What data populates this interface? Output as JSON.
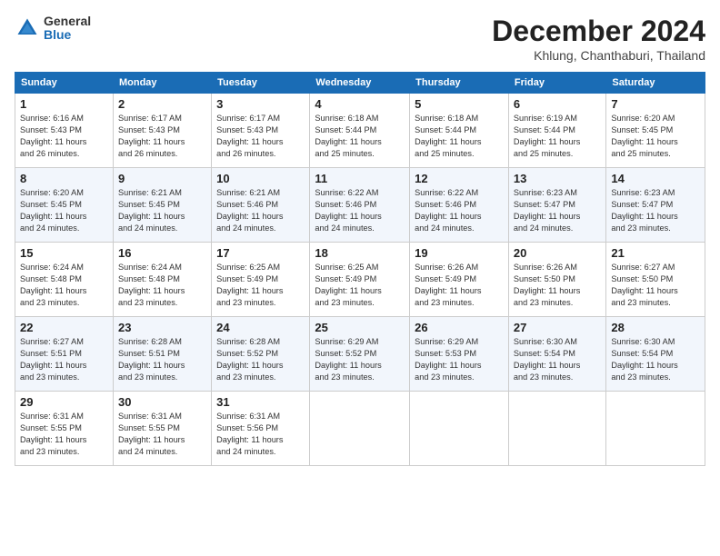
{
  "header": {
    "logo_general": "General",
    "logo_blue": "Blue",
    "month_title": "December 2024",
    "subtitle": "Khlung, Chanthaburi, Thailand"
  },
  "calendar": {
    "days_of_week": [
      "Sunday",
      "Monday",
      "Tuesday",
      "Wednesday",
      "Thursday",
      "Friday",
      "Saturday"
    ],
    "weeks": [
      [
        null,
        null,
        null,
        null,
        null,
        null,
        null
      ]
    ]
  },
  "cells": {
    "w1": [
      {
        "day": "1",
        "info": "Sunrise: 6:16 AM\nSunset: 5:43 PM\nDaylight: 11 hours\nand 26 minutes."
      },
      {
        "day": "2",
        "info": "Sunrise: 6:17 AM\nSunset: 5:43 PM\nDaylight: 11 hours\nand 26 minutes."
      },
      {
        "day": "3",
        "info": "Sunrise: 6:17 AM\nSunset: 5:43 PM\nDaylight: 11 hours\nand 26 minutes."
      },
      {
        "day": "4",
        "info": "Sunrise: 6:18 AM\nSunset: 5:44 PM\nDaylight: 11 hours\nand 25 minutes."
      },
      {
        "day": "5",
        "info": "Sunrise: 6:18 AM\nSunset: 5:44 PM\nDaylight: 11 hours\nand 25 minutes."
      },
      {
        "day": "6",
        "info": "Sunrise: 6:19 AM\nSunset: 5:44 PM\nDaylight: 11 hours\nand 25 minutes."
      },
      {
        "day": "7",
        "info": "Sunrise: 6:20 AM\nSunset: 5:45 PM\nDaylight: 11 hours\nand 25 minutes."
      }
    ],
    "w2": [
      {
        "day": "8",
        "info": "Sunrise: 6:20 AM\nSunset: 5:45 PM\nDaylight: 11 hours\nand 24 minutes."
      },
      {
        "day": "9",
        "info": "Sunrise: 6:21 AM\nSunset: 5:45 PM\nDaylight: 11 hours\nand 24 minutes."
      },
      {
        "day": "10",
        "info": "Sunrise: 6:21 AM\nSunset: 5:46 PM\nDaylight: 11 hours\nand 24 minutes."
      },
      {
        "day": "11",
        "info": "Sunrise: 6:22 AM\nSunset: 5:46 PM\nDaylight: 11 hours\nand 24 minutes."
      },
      {
        "day": "12",
        "info": "Sunrise: 6:22 AM\nSunset: 5:46 PM\nDaylight: 11 hours\nand 24 minutes."
      },
      {
        "day": "13",
        "info": "Sunrise: 6:23 AM\nSunset: 5:47 PM\nDaylight: 11 hours\nand 24 minutes."
      },
      {
        "day": "14",
        "info": "Sunrise: 6:23 AM\nSunset: 5:47 PM\nDaylight: 11 hours\nand 23 minutes."
      }
    ],
    "w3": [
      {
        "day": "15",
        "info": "Sunrise: 6:24 AM\nSunset: 5:48 PM\nDaylight: 11 hours\nand 23 minutes."
      },
      {
        "day": "16",
        "info": "Sunrise: 6:24 AM\nSunset: 5:48 PM\nDaylight: 11 hours\nand 23 minutes."
      },
      {
        "day": "17",
        "info": "Sunrise: 6:25 AM\nSunset: 5:49 PM\nDaylight: 11 hours\nand 23 minutes."
      },
      {
        "day": "18",
        "info": "Sunrise: 6:25 AM\nSunset: 5:49 PM\nDaylight: 11 hours\nand 23 minutes."
      },
      {
        "day": "19",
        "info": "Sunrise: 6:26 AM\nSunset: 5:49 PM\nDaylight: 11 hours\nand 23 minutes."
      },
      {
        "day": "20",
        "info": "Sunrise: 6:26 AM\nSunset: 5:50 PM\nDaylight: 11 hours\nand 23 minutes."
      },
      {
        "day": "21",
        "info": "Sunrise: 6:27 AM\nSunset: 5:50 PM\nDaylight: 11 hours\nand 23 minutes."
      }
    ],
    "w4": [
      {
        "day": "22",
        "info": "Sunrise: 6:27 AM\nSunset: 5:51 PM\nDaylight: 11 hours\nand 23 minutes."
      },
      {
        "day": "23",
        "info": "Sunrise: 6:28 AM\nSunset: 5:51 PM\nDaylight: 11 hours\nand 23 minutes."
      },
      {
        "day": "24",
        "info": "Sunrise: 6:28 AM\nSunset: 5:52 PM\nDaylight: 11 hours\nand 23 minutes."
      },
      {
        "day": "25",
        "info": "Sunrise: 6:29 AM\nSunset: 5:52 PM\nDaylight: 11 hours\nand 23 minutes."
      },
      {
        "day": "26",
        "info": "Sunrise: 6:29 AM\nSunset: 5:53 PM\nDaylight: 11 hours\nand 23 minutes."
      },
      {
        "day": "27",
        "info": "Sunrise: 6:30 AM\nSunset: 5:54 PM\nDaylight: 11 hours\nand 23 minutes."
      },
      {
        "day": "28",
        "info": "Sunrise: 6:30 AM\nSunset: 5:54 PM\nDaylight: 11 hours\nand 23 minutes."
      }
    ],
    "w5": [
      {
        "day": "29",
        "info": "Sunrise: 6:31 AM\nSunset: 5:55 PM\nDaylight: 11 hours\nand 23 minutes."
      },
      {
        "day": "30",
        "info": "Sunrise: 6:31 AM\nSunset: 5:55 PM\nDaylight: 11 hours\nand 24 minutes."
      },
      {
        "day": "31",
        "info": "Sunrise: 6:31 AM\nSunset: 5:56 PM\nDaylight: 11 hours\nand 24 minutes."
      },
      null,
      null,
      null,
      null
    ]
  }
}
